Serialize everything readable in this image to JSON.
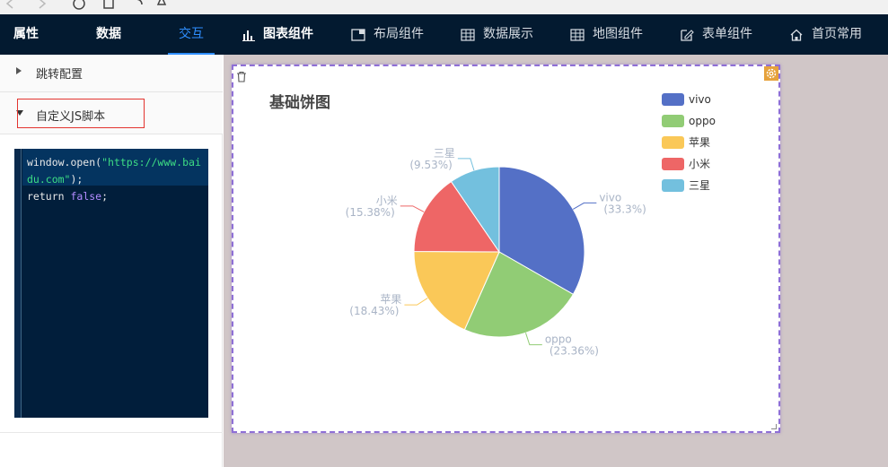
{
  "tabs": [
    {
      "label": "属性"
    },
    {
      "label": "数据"
    },
    {
      "label": "交互"
    }
  ],
  "nav": [
    {
      "label": "图表组件",
      "icon": "bar-chart-icon"
    },
    {
      "label": "布局组件",
      "icon": "layout-icon"
    },
    {
      "label": "数据展示",
      "icon": "table-icon"
    },
    {
      "label": "地图组件",
      "icon": "map-grid-icon"
    },
    {
      "label": "表单组件",
      "icon": "form-edit-icon"
    },
    {
      "label": "首页常用",
      "icon": "home-icon"
    }
  ],
  "panel": {
    "jump_config": "跳转配置",
    "custom_js": "自定义JS脚本",
    "code": {
      "line1_fn": "window.open(",
      "line1_str": "\"https://www.baidu.com\"",
      "line1_end": ");",
      "line2_kw": "return",
      "line2_val": "false",
      "line2_end": ";"
    }
  },
  "colors": {
    "nav_bg": "#031a30",
    "accent": "#2f8fff",
    "selection_border": "#8e6fd6",
    "canvas_bg": "#d0c6c7"
  },
  "chart_data": {
    "type": "pie",
    "title": "基础饼图",
    "legend_position": "top-right",
    "slices": [
      {
        "name": "vivo",
        "value": 33.3,
        "label": "(33.3%)",
        "color": "#5470c6"
      },
      {
        "name": "oppo",
        "value": 23.36,
        "label": "(23.36%)",
        "color": "#91cc75"
      },
      {
        "name": "苹果",
        "value": 18.43,
        "label": "(18.43%)",
        "color": "#fac858"
      },
      {
        "name": "小米",
        "value": 15.38,
        "label": "(15.38%)",
        "color": "#ee6666"
      },
      {
        "name": "三星",
        "value": 9.53,
        "label": "(9.53%)",
        "color": "#73c0de"
      }
    ]
  }
}
